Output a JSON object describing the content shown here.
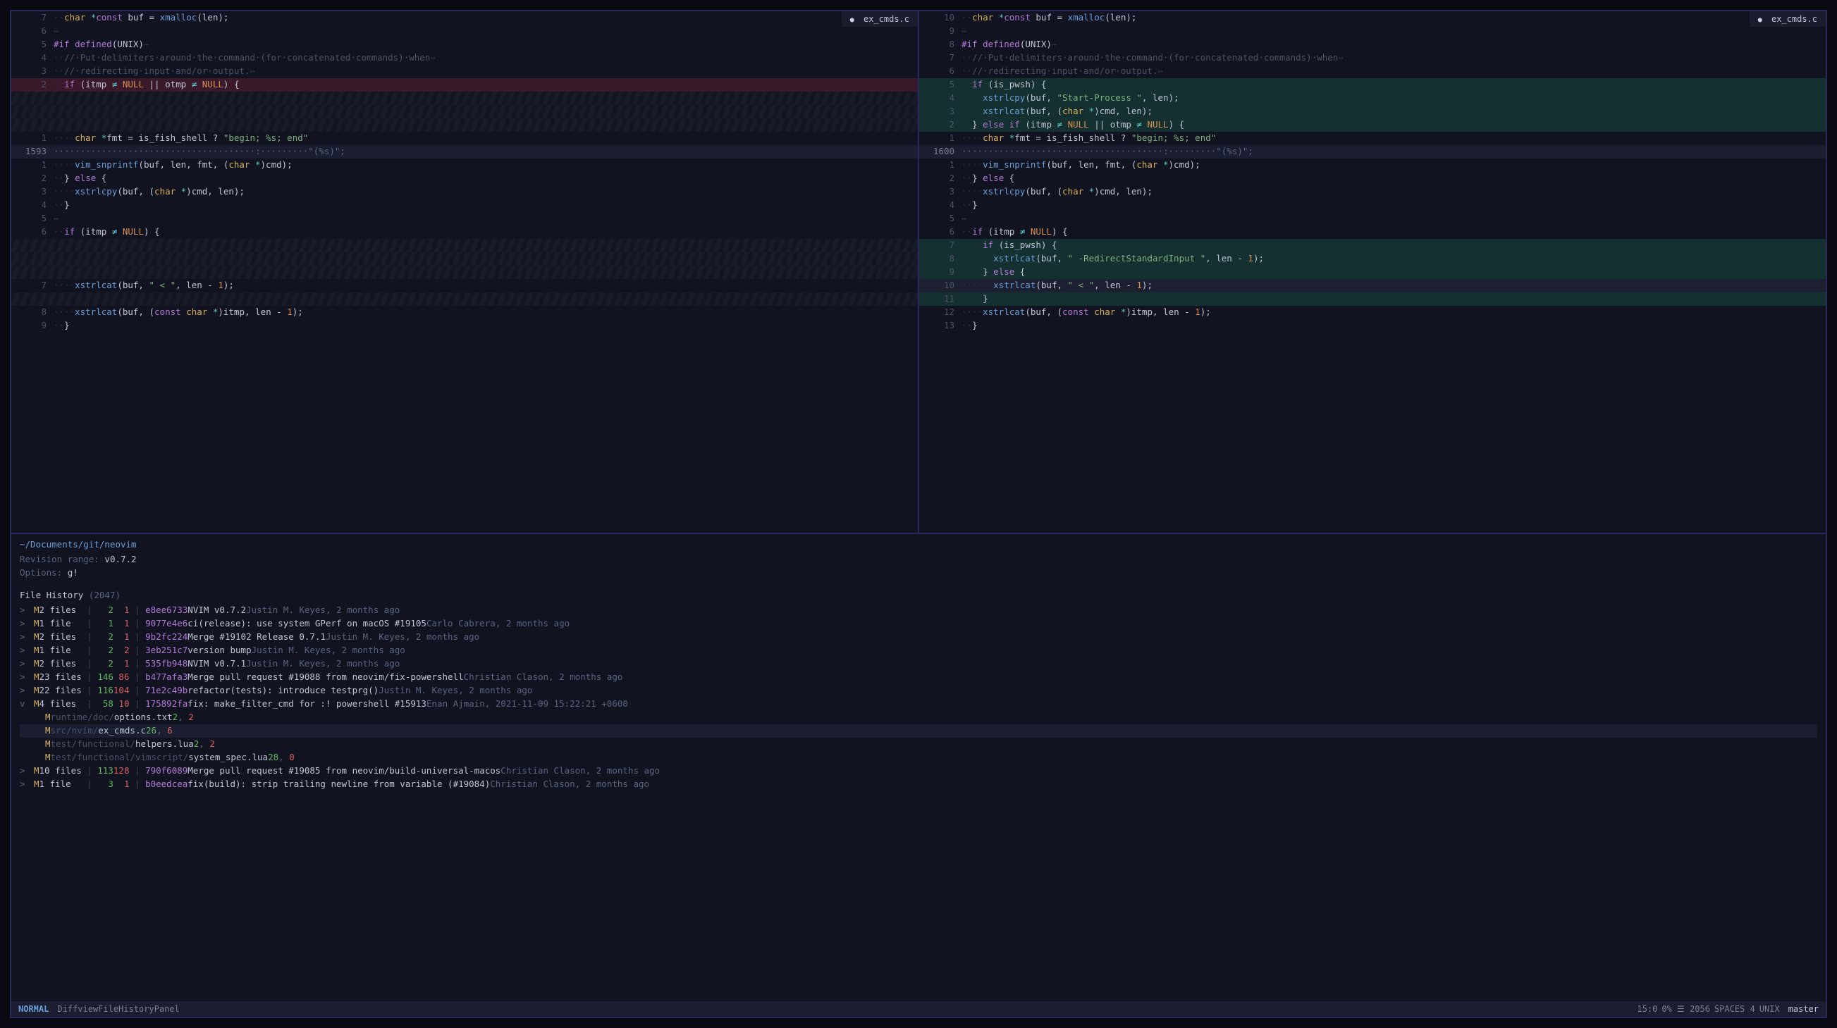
{
  "tabs": {
    "left": "ex_cmds.c",
    "right": "ex_cmds.c"
  },
  "fold_label_left": "\"(%s)\";",
  "fold_label_right": "\"(%s)\";",
  "fold_num_left": "1593",
  "fold_num_right": "1600",
  "left_lines": [
    {
      "n": "7",
      "bg": "",
      "html": "<span class='c-ws'>··</span><span class='c-type'>char</span> <span class='c-op'>*</span><span class='c-kw'>const</span> <span class='c-default'>buf = </span><span class='c-func'>xmalloc</span><span class='c-default'>(len);</span>"
    },
    {
      "n": "6",
      "bg": "",
      "html": "<span class='c-ws'>↔</span>"
    },
    {
      "n": "5",
      "bg": "",
      "html": "<span class='c-kw'>#if defined</span><span class='c-default'>(UNIX)</span><span class='c-ws'>↔</span>"
    },
    {
      "n": "4",
      "bg": "",
      "html": "<span class='c-ws'>··</span><span class='c-cmt'>//·Put·delimiters·around·the·command·(for·concatenated·commands)·when</span><span class='c-ws'>↔</span>"
    },
    {
      "n": "3",
      "bg": "",
      "html": "<span class='c-ws'>··</span><span class='c-cmt'>//·redirecting·input·and/or·output.</span><span class='c-ws'>↔</span>"
    },
    {
      "n": "2",
      "bg": "bg-del",
      "html": "<span class='c-ws'>··</span><span class='c-kw'>if</span><span class='c-default'> (itmp </span><span class='c-op'>≠</span><span class='c-default'> </span><span class='c-const'>NULL</span><span class='c-default'> || otmp </span><span class='c-op'>≠</span><span class='c-default'> </span><span class='c-const'>NULL</span><span class='c-default'>) {</span>"
    },
    {
      "n": "",
      "bg": "bg-fill",
      "html": " "
    },
    {
      "n": "",
      "bg": "bg-fill",
      "html": " "
    },
    {
      "n": "",
      "bg": "bg-fill",
      "html": " "
    },
    {
      "n": "1",
      "bg": "",
      "html": "<span class='c-ws'>····</span><span class='c-type'>char</span> <span class='c-op'>*</span><span class='c-default'>fmt = is_fish_shell ? </span><span class='c-str'>\"begin; %s; end\"</span>"
    },
    {
      "n": "FOLD_L",
      "bg": "bg-fold",
      "html": ""
    },
    {
      "n": "1",
      "bg": "",
      "html": "<span class='c-ws'>····</span><span class='c-func'>vim_snprintf</span><span class='c-default'>(buf, len, fmt, (</span><span class='c-type'>char</span> <span class='c-op'>*</span><span class='c-default'>)cmd);</span>"
    },
    {
      "n": "2",
      "bg": "",
      "html": "<span class='c-ws'>··</span><span class='c-default'>} </span><span class='c-kw'>else</span><span class='c-default'> {</span>"
    },
    {
      "n": "3",
      "bg": "",
      "html": "<span class='c-ws'>····</span><span class='c-func'>xstrlcpy</span><span class='c-default'>(buf, (</span><span class='c-type'>char</span> <span class='c-op'>*</span><span class='c-default'>)cmd, len);</span>"
    },
    {
      "n": "4",
      "bg": "",
      "html": "<span class='c-ws'>··</span><span class='c-default'>}</span>"
    },
    {
      "n": "5",
      "bg": "",
      "html": "<span class='c-ws'>↔</span>"
    },
    {
      "n": "6",
      "bg": "",
      "html": "<span class='c-ws'>··</span><span class='c-kw'>if</span><span class='c-default'> (itmp </span><span class='c-op'>≠</span><span class='c-default'> </span><span class='c-const'>NULL</span><span class='c-default'>) {</span>"
    },
    {
      "n": "",
      "bg": "bg-fill",
      "html": " "
    },
    {
      "n": "",
      "bg": "bg-fill",
      "html": " "
    },
    {
      "n": "",
      "bg": "bg-fill",
      "html": " "
    },
    {
      "n": "7",
      "bg": "",
      "html": "<span class='c-ws'>····</span><span class='c-func'>xstrlcat</span><span class='c-default'>(buf, </span><span class='c-str'>\" &lt; \"</span><span class='c-default'>, len - </span><span class='c-num'>1</span><span class='c-default'>);</span>"
    },
    {
      "n": "",
      "bg": "bg-fill",
      "html": " "
    },
    {
      "n": "8",
      "bg": "",
      "html": "<span class='c-ws'>····</span><span class='c-func'>xstrlcat</span><span class='c-default'>(buf, (</span><span class='c-kw'>const</span> <span class='c-type'>char</span> <span class='c-op'>*</span><span class='c-default'>)itmp, len - </span><span class='c-num'>1</span><span class='c-default'>);</span>"
    },
    {
      "n": "9",
      "bg": "",
      "html": "<span class='c-ws'>··</span><span class='c-default'>}</span>"
    }
  ],
  "right_lines": [
    {
      "n": "10",
      "bg": "",
      "html": "<span class='c-ws'>··</span><span class='c-type'>char</span> <span class='c-op'>*</span><span class='c-kw'>const</span> <span class='c-default'>buf = </span><span class='c-func'>xmalloc</span><span class='c-default'>(len);</span>"
    },
    {
      "n": "9",
      "bg": "",
      "html": "<span class='c-ws'>↔</span>"
    },
    {
      "n": "8",
      "bg": "",
      "html": "<span class='c-kw'>#if defined</span><span class='c-default'>(UNIX)</span><span class='c-ws'>↔</span>"
    },
    {
      "n": "7",
      "bg": "",
      "html": "<span class='c-ws'>··</span><span class='c-cmt'>//·Put·delimiters·around·the·command·(for·concatenated·commands)·when</span><span class='c-ws'>↔</span>"
    },
    {
      "n": "6",
      "bg": "",
      "html": "<span class='c-ws'>··</span><span class='c-cmt'>//·redirecting·input·and/or·output.</span><span class='c-ws'>↔</span>"
    },
    {
      "n": "5",
      "bg": "bg-add",
      "html": "<span class='c-ws'>··</span><span class='c-kw'>if</span><span class='c-default'> (is_pwsh) {</span>"
    },
    {
      "n": "4",
      "bg": "bg-add",
      "html": "<span class='c-ws'>····</span><span class='c-func'>xstrlcpy</span><span class='c-default'>(buf, </span><span class='c-str'>\"Start-Process \"</span><span class='c-default'>, len);</span>"
    },
    {
      "n": "3",
      "bg": "bg-add",
      "html": "<span class='c-ws'>····</span><span class='c-func'>xstrlcat</span><span class='c-default'>(buf, (</span><span class='c-type'>char</span> <span class='c-op'>*</span><span class='c-default'>)cmd, len);</span>"
    },
    {
      "n": "2",
      "bg": "bg-add",
      "html": "<span class='c-ws'>··</span><span class='c-default'>} </span><span class='c-kw'>else if</span><span class='c-default'> (itmp </span><span class='c-op'>≠</span><span class='c-default'> </span><span class='c-const'>NULL</span><span class='c-default'> || otmp </span><span class='c-op'>≠</span><span class='c-default'> </span><span class='c-const'>NULL</span><span class='c-default'>) {</span>"
    },
    {
      "n": "1",
      "bg": "",
      "html": "<span class='c-ws'>····</span><span class='c-type'>char</span> <span class='c-op'>*</span><span class='c-default'>fmt = is_fish_shell ? </span><span class='c-str'>\"begin; %s; end\"</span>"
    },
    {
      "n": "FOLD_R",
      "bg": "bg-fold",
      "html": ""
    },
    {
      "n": "1",
      "bg": "",
      "html": "<span class='c-ws'>····</span><span class='c-func'>vim_snprintf</span><span class='c-default'>(buf, len, fmt, (</span><span class='c-type'>char</span> <span class='c-op'>*</span><span class='c-default'>)cmd);</span>"
    },
    {
      "n": "2",
      "bg": "",
      "html": "<span class='c-ws'>··</span><span class='c-default'>} </span><span class='c-kw'>else</span><span class='c-default'> {</span>"
    },
    {
      "n": "3",
      "bg": "",
      "html": "<span class='c-ws'>····</span><span class='c-func'>xstrlcpy</span><span class='c-default'>(buf, (</span><span class='c-type'>char</span> <span class='c-op'>*</span><span class='c-default'>)cmd, len);</span>"
    },
    {
      "n": "4",
      "bg": "",
      "html": "<span class='c-ws'>··</span><span class='c-default'>}</span>"
    },
    {
      "n": "5",
      "bg": "",
      "html": "<span class='c-ws'>↔</span>"
    },
    {
      "n": "6",
      "bg": "",
      "html": "<span class='c-ws'>··</span><span class='c-kw'>if</span><span class='c-default'> (itmp </span><span class='c-op'>≠</span><span class='c-default'> </span><span class='c-const'>NULL</span><span class='c-default'>) {</span>"
    },
    {
      "n": "7",
      "bg": "bg-add",
      "html": "<span class='c-ws'>····</span><span class='c-kw'>if</span><span class='c-default'> (is_pwsh) {</span>"
    },
    {
      "n": "8",
      "bg": "bg-add",
      "html": "<span class='c-ws'>······</span><span class='c-func'>xstrlcat</span><span class='c-default'>(buf, </span><span class='c-str'>\" -RedirectStandardInput \"</span><span class='c-default'>, len - </span><span class='c-num'>1</span><span class='c-default'>);</span>"
    },
    {
      "n": "9",
      "bg": "bg-add",
      "html": "<span class='c-ws'>····</span><span class='c-default'>} </span><span class='c-kw'>else</span><span class='c-default'> {</span>"
    },
    {
      "n": "10",
      "bg": "bg-cursor",
      "html": "<span class='c-ws'>······</span><span class='c-func'>xstrlcat</span><span class='c-default'>(buf, </span><span class='c-str'>\" &lt; \"</span><span class='c-default'>, len - </span><span class='c-num'>1</span><span class='c-default'>);</span>"
    },
    {
      "n": "11",
      "bg": "bg-add",
      "html": "<span class='c-ws'>····</span><span class='c-default'>}</span>"
    },
    {
      "n": "12",
      "bg": "",
      "html": "<span class='c-ws'>····</span><span class='c-func'>xstrlcat</span><span class='c-default'>(buf, (</span><span class='c-kw'>const</span> <span class='c-type'>char</span> <span class='c-op'>*</span><span class='c-default'>)itmp, len - </span><span class='c-num'>1</span><span class='c-default'>);</span>"
    },
    {
      "n": "13",
      "bg": "",
      "html": "<span class='c-ws'>··</span><span class='c-default'>}</span>"
    }
  ],
  "history": {
    "path": "~/Documents/git/neovim",
    "rev_label": "Revision range:",
    "rev_value": "v0.7.2",
    "opt_label": "Options:",
    "opt_value": "g!",
    "title": "File History",
    "count": "(2047)"
  },
  "commits": [
    {
      "open": ">",
      "m": "M",
      "files": "2 files",
      "plus": "2",
      "minus": "1",
      "hash": "e8ee6733",
      "msg": "NVIM v0.7.2",
      "meta": "Justin M. Keyes, 2 months ago",
      "sel": false
    },
    {
      "open": ">",
      "m": "M",
      "files": "1 file ",
      "plus": "1",
      "minus": "1",
      "hash": "9077e4e6",
      "msg": "ci(release): use system GPerf on macOS #19105",
      "meta": "Carlo Cabrera, 2 months ago",
      "sel": false
    },
    {
      "open": ">",
      "m": "M",
      "files": "2 files",
      "plus": "2",
      "minus": "1",
      "hash": "9b2fc224",
      "msg": "Merge #19102 Release 0.7.1",
      "meta": "Justin M. Keyes, 2 months ago",
      "sel": false
    },
    {
      "open": ">",
      "m": "M",
      "files": "1 file ",
      "plus": "2",
      "minus": "2",
      "hash": "3eb251c7",
      "msg": "version bump",
      "meta": "Justin M. Keyes, 2 months ago",
      "sel": false
    },
    {
      "open": ">",
      "m": "M",
      "files": "2 files",
      "plus": "2",
      "minus": "1",
      "hash": "535fb948",
      "msg": "NVIM v0.7.1",
      "meta": "Justin M. Keyes, 2 months ago",
      "sel": false
    },
    {
      "open": ">",
      "m": "M",
      "files": "23 files",
      "plus": "146",
      "minus": "86",
      "hash": "b477afa3",
      "msg": "Merge pull request #19088 from neovim/fix-powershell",
      "meta": "Christian Clason, 2 months ago",
      "sel": false
    },
    {
      "open": ">",
      "m": "M",
      "files": "22 files",
      "plus": "116",
      "minus": "104",
      "hash": "71e2c49b",
      "msg": "refactor(tests): introduce testprg()",
      "meta": "Justin M. Keyes, 2 months ago",
      "sel": false
    },
    {
      "open": "v",
      "m": "M",
      "files": "4 files",
      "plus": "58",
      "minus": "10",
      "hash": "175892fa",
      "msg": "fix: make_filter_cmd for :! powershell #15913",
      "meta": "Enan Ajmain, 2021-11-09 15:22:21 +0600",
      "sel": false,
      "children": [
        {
          "m": "M",
          "icon": "f-icon",
          "iconChar": "",
          "dir": "runtime/doc/",
          "name": "options.txt",
          "plus": "2",
          "minus": "2",
          "sel": false
        },
        {
          "m": "M",
          "icon": "f-icon-c",
          "iconChar": "",
          "dir": "src/nvim/",
          "name": "ex_cmds.c",
          "plus": "26",
          "minus": "6",
          "sel": true
        },
        {
          "m": "M",
          "icon": "f-icon-lua",
          "iconChar": "",
          "dir": "test/functional/",
          "name": "helpers.lua",
          "plus": "2",
          "minus": "2",
          "sel": false
        },
        {
          "m": "M",
          "icon": "f-icon-lua",
          "iconChar": "",
          "dir": "test/functional/vimscript/",
          "name": "system_spec.lua",
          "plus": "28",
          "minus": "0",
          "sel": false
        }
      ]
    },
    {
      "open": ">",
      "m": "M",
      "files": "10 files",
      "plus": "113",
      "minus": "128",
      "hash": "790f6089",
      "msg": "Merge pull request #19085 from neovim/build-universal-macos",
      "meta": "Christian Clason, 2 months ago",
      "sel": false
    },
    {
      "open": ">",
      "m": "M",
      "files": "1 file ",
      "plus": "3",
      "minus": "1",
      "hash": "b0eedcea",
      "msg": "fix(build): strip trailing newline from variable (#19084)",
      "meta": "Christian Clason, 2 months ago",
      "sel": false
    }
  ],
  "statusline": {
    "mode": "NORMAL",
    "file_icon": "",
    "file": "DiffviewFileHistoryPanel",
    "pos": "15:0",
    "pct": "0% ☰ 2056",
    "spaces": " SPACES 4",
    "os": " UNIX",
    "branch_icon": "",
    "branch": "master"
  }
}
